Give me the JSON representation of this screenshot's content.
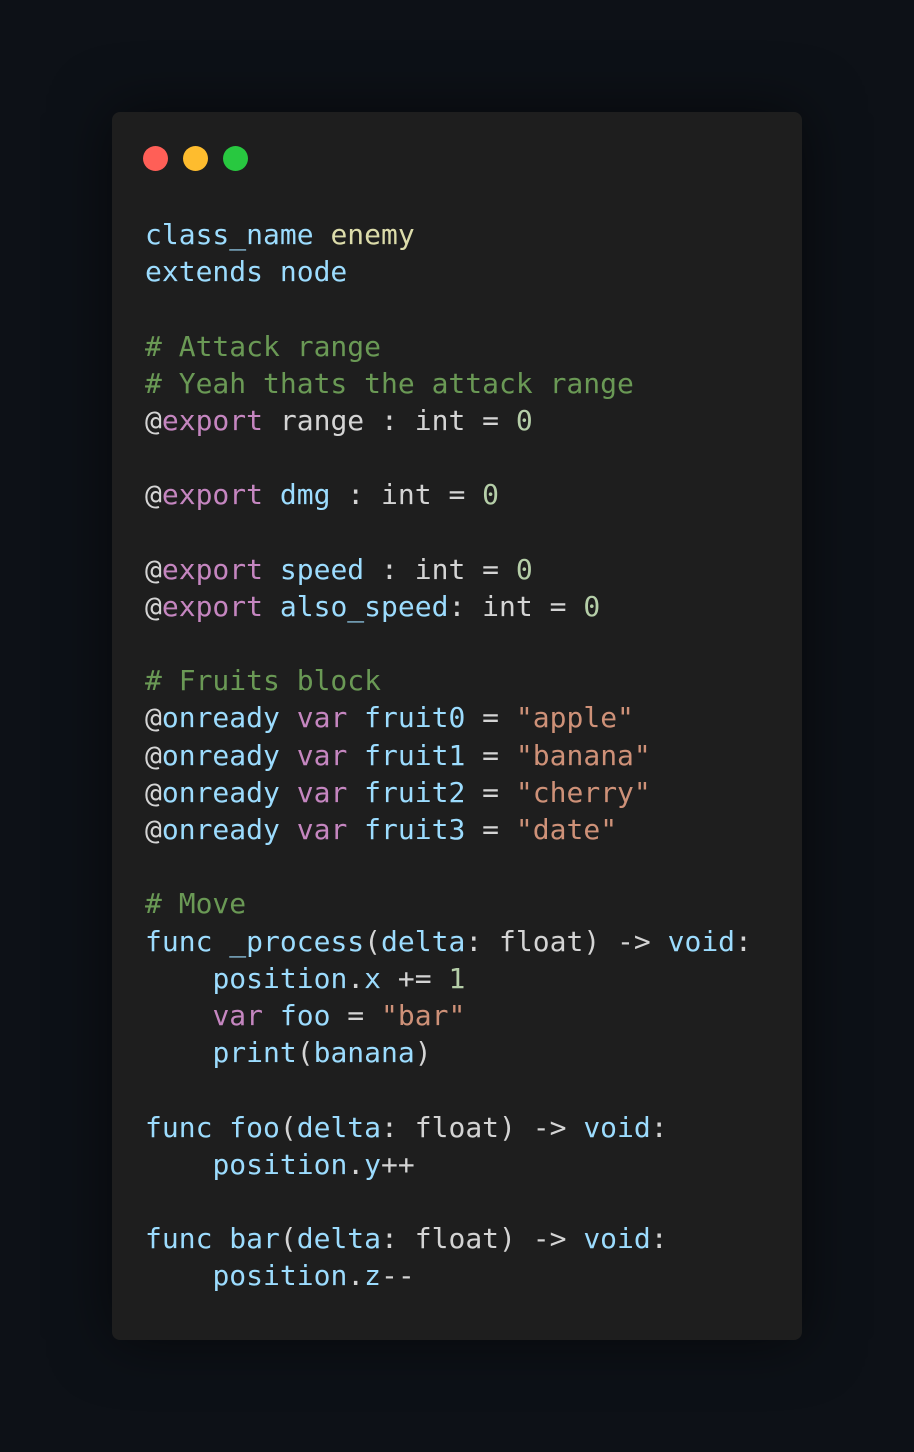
{
  "window": {
    "controls": [
      "close",
      "minimize",
      "maximize"
    ]
  },
  "code": {
    "lines": [
      [
        {
          "t": "class_name ",
          "c": "kw-blue"
        },
        {
          "t": "enemy",
          "c": "cls"
        }
      ],
      [
        {
          "t": "extends ",
          "c": "kw-blue"
        },
        {
          "t": "node",
          "c": "kw-blue"
        }
      ],
      [],
      [
        {
          "t": "# Attack range",
          "c": "cmt"
        }
      ],
      [
        {
          "t": "# Yeah thats the attack range",
          "c": "cmt"
        }
      ],
      [
        {
          "t": "@",
          "c": "plain"
        },
        {
          "t": "export",
          "c": "kw-purple"
        },
        {
          "t": " range : int = ",
          "c": "plain"
        },
        {
          "t": "0",
          "c": "num"
        }
      ],
      [],
      [
        {
          "t": "@",
          "c": "plain"
        },
        {
          "t": "export",
          "c": "kw-purple"
        },
        {
          "t": " ",
          "c": "plain"
        },
        {
          "t": "dmg",
          "c": "kw-blue"
        },
        {
          "t": " : int = ",
          "c": "plain"
        },
        {
          "t": "0",
          "c": "num"
        }
      ],
      [],
      [
        {
          "t": "@",
          "c": "plain"
        },
        {
          "t": "export",
          "c": "kw-purple"
        },
        {
          "t": " ",
          "c": "plain"
        },
        {
          "t": "speed",
          "c": "kw-blue"
        },
        {
          "t": " : int = ",
          "c": "plain"
        },
        {
          "t": "0",
          "c": "num"
        }
      ],
      [
        {
          "t": "@",
          "c": "plain"
        },
        {
          "t": "export",
          "c": "kw-purple"
        },
        {
          "t": " ",
          "c": "plain"
        },
        {
          "t": "also_speed",
          "c": "kw-blue"
        },
        {
          "t": ": int = ",
          "c": "plain"
        },
        {
          "t": "0",
          "c": "num"
        }
      ],
      [],
      [
        {
          "t": "# Fruits block",
          "c": "cmt"
        }
      ],
      [
        {
          "t": "@",
          "c": "plain"
        },
        {
          "t": "onready",
          "c": "kw-blue"
        },
        {
          "t": " ",
          "c": "plain"
        },
        {
          "t": "var",
          "c": "kw-purple"
        },
        {
          "t": " ",
          "c": "plain"
        },
        {
          "t": "fruit0",
          "c": "kw-blue"
        },
        {
          "t": " = ",
          "c": "plain"
        },
        {
          "t": "\"apple\"",
          "c": "str"
        }
      ],
      [
        {
          "t": "@",
          "c": "plain"
        },
        {
          "t": "onready",
          "c": "kw-blue"
        },
        {
          "t": " ",
          "c": "plain"
        },
        {
          "t": "var",
          "c": "kw-purple"
        },
        {
          "t": " ",
          "c": "plain"
        },
        {
          "t": "fruit1",
          "c": "kw-blue"
        },
        {
          "t": " = ",
          "c": "plain"
        },
        {
          "t": "\"banana\"",
          "c": "str"
        }
      ],
      [
        {
          "t": "@",
          "c": "plain"
        },
        {
          "t": "onready",
          "c": "kw-blue"
        },
        {
          "t": " ",
          "c": "plain"
        },
        {
          "t": "var",
          "c": "kw-purple"
        },
        {
          "t": " ",
          "c": "plain"
        },
        {
          "t": "fruit2",
          "c": "kw-blue"
        },
        {
          "t": " = ",
          "c": "plain"
        },
        {
          "t": "\"cherry\"",
          "c": "str"
        }
      ],
      [
        {
          "t": "@",
          "c": "plain"
        },
        {
          "t": "onready",
          "c": "kw-blue"
        },
        {
          "t": " ",
          "c": "plain"
        },
        {
          "t": "var",
          "c": "kw-purple"
        },
        {
          "t": " ",
          "c": "plain"
        },
        {
          "t": "fruit3",
          "c": "kw-blue"
        },
        {
          "t": " = ",
          "c": "plain"
        },
        {
          "t": "\"date\"",
          "c": "str"
        }
      ],
      [],
      [
        {
          "t": "# Move",
          "c": "cmt"
        }
      ],
      [
        {
          "t": "func",
          "c": "kw-blue"
        },
        {
          "t": " ",
          "c": "plain"
        },
        {
          "t": "_process",
          "c": "kw-blue"
        },
        {
          "t": "(",
          "c": "plain"
        },
        {
          "t": "delta",
          "c": "kw-blue"
        },
        {
          "t": ": float) -> ",
          "c": "plain"
        },
        {
          "t": "void",
          "c": "kw-blue"
        },
        {
          "t": ":",
          "c": "plain"
        }
      ],
      [
        {
          "t": "    ",
          "c": "plain"
        },
        {
          "t": "position",
          "c": "kw-blue"
        },
        {
          "t": ".",
          "c": "plain"
        },
        {
          "t": "x",
          "c": "kw-blue"
        },
        {
          "t": " += ",
          "c": "plain"
        },
        {
          "t": "1",
          "c": "num"
        }
      ],
      [
        {
          "t": "    ",
          "c": "plain"
        },
        {
          "t": "var",
          "c": "kw-purple"
        },
        {
          "t": " ",
          "c": "plain"
        },
        {
          "t": "foo",
          "c": "kw-blue"
        },
        {
          "t": " = ",
          "c": "plain"
        },
        {
          "t": "\"bar\"",
          "c": "str"
        }
      ],
      [
        {
          "t": "    ",
          "c": "plain"
        },
        {
          "t": "print",
          "c": "kw-blue"
        },
        {
          "t": "(",
          "c": "plain"
        },
        {
          "t": "banana",
          "c": "kw-blue"
        },
        {
          "t": ")",
          "c": "plain"
        }
      ],
      [],
      [
        {
          "t": "func",
          "c": "kw-blue"
        },
        {
          "t": " ",
          "c": "plain"
        },
        {
          "t": "foo",
          "c": "kw-blue"
        },
        {
          "t": "(",
          "c": "plain"
        },
        {
          "t": "delta",
          "c": "kw-blue"
        },
        {
          "t": ": float) -> ",
          "c": "plain"
        },
        {
          "t": "void",
          "c": "kw-blue"
        },
        {
          "t": ":",
          "c": "plain"
        }
      ],
      [
        {
          "t": "    ",
          "c": "plain"
        },
        {
          "t": "position",
          "c": "kw-blue"
        },
        {
          "t": ".",
          "c": "plain"
        },
        {
          "t": "y",
          "c": "kw-blue"
        },
        {
          "t": "++",
          "c": "plain"
        }
      ],
      [],
      [
        {
          "t": "func",
          "c": "kw-blue"
        },
        {
          "t": " ",
          "c": "plain"
        },
        {
          "t": "bar",
          "c": "kw-blue"
        },
        {
          "t": "(",
          "c": "plain"
        },
        {
          "t": "delta",
          "c": "kw-blue"
        },
        {
          "t": ": float) -> ",
          "c": "plain"
        },
        {
          "t": "void",
          "c": "kw-blue"
        },
        {
          "t": ":",
          "c": "plain"
        }
      ],
      [
        {
          "t": "    ",
          "c": "plain"
        },
        {
          "t": "position",
          "c": "kw-blue"
        },
        {
          "t": ".",
          "c": "plain"
        },
        {
          "t": "z",
          "c": "kw-blue"
        },
        {
          "t": "--",
          "c": "plain"
        }
      ]
    ]
  },
  "colors": {
    "page_background": "#0d1117",
    "window_background": "#1e1e1e",
    "close_dot": "#ff5f57",
    "minimize_dot": "#febc2e",
    "maximize_dot": "#28c840",
    "keyword_blue": "#9cdcfe",
    "keyword_purple": "#c586c0",
    "class_name": "#dcdcaa",
    "comment": "#6a9955",
    "number": "#b5cea8",
    "string": "#ce9178",
    "plain": "#d4d4d4"
  }
}
